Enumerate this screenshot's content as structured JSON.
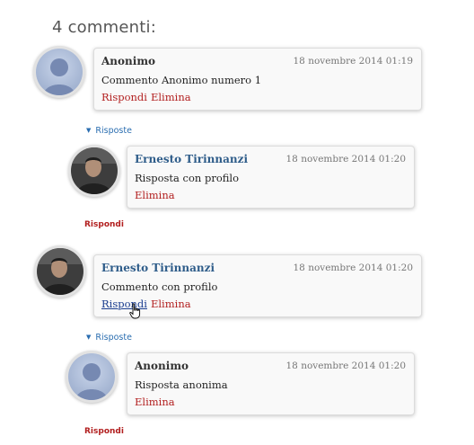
{
  "heading": "4 commenti:",
  "comments": [
    {
      "author": "Anonimo",
      "date": "18 novembre 2014 01:19",
      "text": "Commento Anonimo numero 1",
      "reply_label": "Rispondi",
      "delete_label": "Elimina",
      "avatar": "anonymous-avatar-icon",
      "toggle_label": "Risposte",
      "replies": [
        {
          "author": "Ernesto Tirinnanzi",
          "date": "18 novembre 2014 01:20",
          "text": "Risposta con profilo",
          "delete_label": "Elimina",
          "avatar": "profile-photo"
        }
      ],
      "thread_reply_label": "Rispondi"
    },
    {
      "author": "Ernesto Tirinnanzi",
      "date": "18 novembre 2014 01:20",
      "text": "Commento con profilo",
      "reply_label": "Rispondi",
      "delete_label": "Elimina",
      "avatar": "profile-photo",
      "toggle_label": "Risposte",
      "replies": [
        {
          "author": "Anonimo",
          "date": "18 novembre 2014 01:20",
          "text": "Risposta anonima",
          "delete_label": "Elimina",
          "avatar": "anonymous-avatar-icon"
        }
      ],
      "thread_reply_label": "Rispondi"
    }
  ],
  "colors": {
    "link_red": "#b21f1f",
    "profile_author": "#2f5d8a",
    "toggle_blue": "#2a6db0"
  }
}
